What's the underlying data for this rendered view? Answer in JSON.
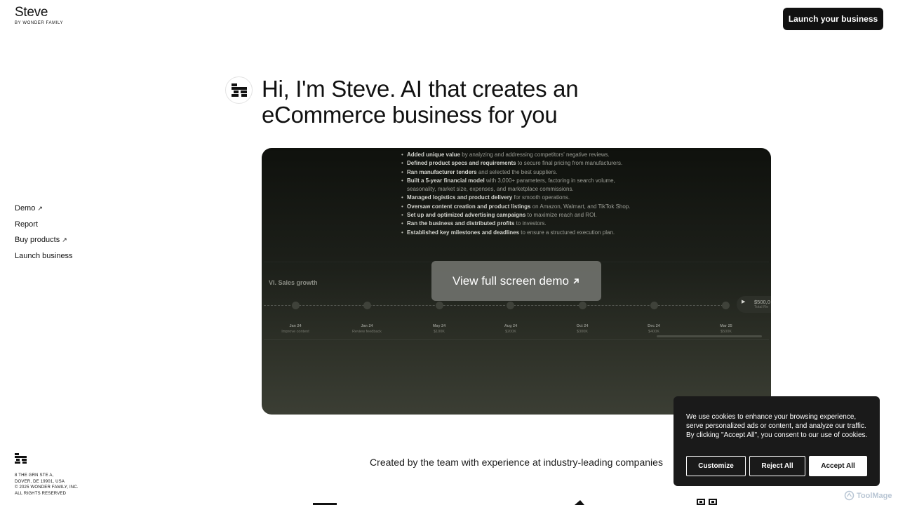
{
  "brand": {
    "name": "Steve",
    "subtitle": "BY WONDER FAMILY"
  },
  "header": {
    "cta_label": "Launch your business"
  },
  "side_nav": {
    "items": [
      {
        "label": "Demo",
        "external": true,
        "arrow": "↗"
      },
      {
        "label": "Report",
        "external": false
      },
      {
        "label": "Buy products",
        "external": true,
        "arrow": "↗"
      },
      {
        "label": "Launch business",
        "external": false
      }
    ]
  },
  "hero": {
    "title": "Hi, I'm Steve. AI that creates an eCommerce business for you"
  },
  "demo": {
    "items": [
      {
        "bold": "Added unique value",
        "rest": " by analyzing and addressing competitors' negative reviews."
      },
      {
        "bold": "Defined product specs and requirements",
        "rest": " to secure final pricing from manufacturers."
      },
      {
        "bold": "Ran manufacturer tenders",
        "rest": " and selected the best suppliers."
      },
      {
        "bold": "Built a 5-year financial model",
        "rest": " with 3,000+ parameters, factoring in search volume, seasonality, market size, expenses, and marketplace commissions."
      },
      {
        "bold": "Managed logistics and product delivery",
        "rest": " for smooth operations."
      },
      {
        "bold": "Oversaw content creation and product listings",
        "rest": " on Amazon, Walmart, and TikTok Shop."
      },
      {
        "bold": "Set up and optimized advertising campaigns",
        "rest": " to maximize reach and ROI."
      },
      {
        "bold": "Ran the business and distributed profits",
        "rest": " to investors."
      },
      {
        "bold": "Established key milestones and deadlines",
        "rest": " to ensure a structured execution plan."
      }
    ],
    "section_label": "VI. Sales growth",
    "timeline": [
      {
        "date": "Jan 24",
        "sub": "Improve content"
      },
      {
        "date": "Jan 24",
        "sub": "Review feedback"
      },
      {
        "date": "May 24",
        "sub": "$100K"
      },
      {
        "date": "Aug 24",
        "sub": "$200K"
      },
      {
        "date": "Oct 24",
        "sub": "$300K"
      },
      {
        "date": "Dec 24",
        "sub": "$400K"
      },
      {
        "date": "Mar 25",
        "sub": "$500K"
      }
    ],
    "final_value": "$500,0",
    "final_sub": "Total Re",
    "button_label": "View full screen demo",
    "button_icon": "arrow-up-right-icon"
  },
  "created_by": "Created by the team with experience at industry-leading companies",
  "footer": {
    "lines": [
      "8 THE GRN STE A,",
      "DOVER, DE 19901, USA",
      "© 2025 WONDER FAMILY, INC.",
      "ALL RIGHTS RESERVED"
    ]
  },
  "cookie": {
    "text": "We use cookies to enhance your browsing experience, serve personalized ads or content, and analyze our traffic. By clicking \"Accept All\", you consent to our use of cookies.",
    "customize": "Customize",
    "reject": "Reject All",
    "accept": "Accept All"
  },
  "watermark": "ToolMage",
  "colors": {
    "primary": "#111111",
    "demo_bg": "#1d201a",
    "cookie_bg": "#1a1a1a"
  }
}
